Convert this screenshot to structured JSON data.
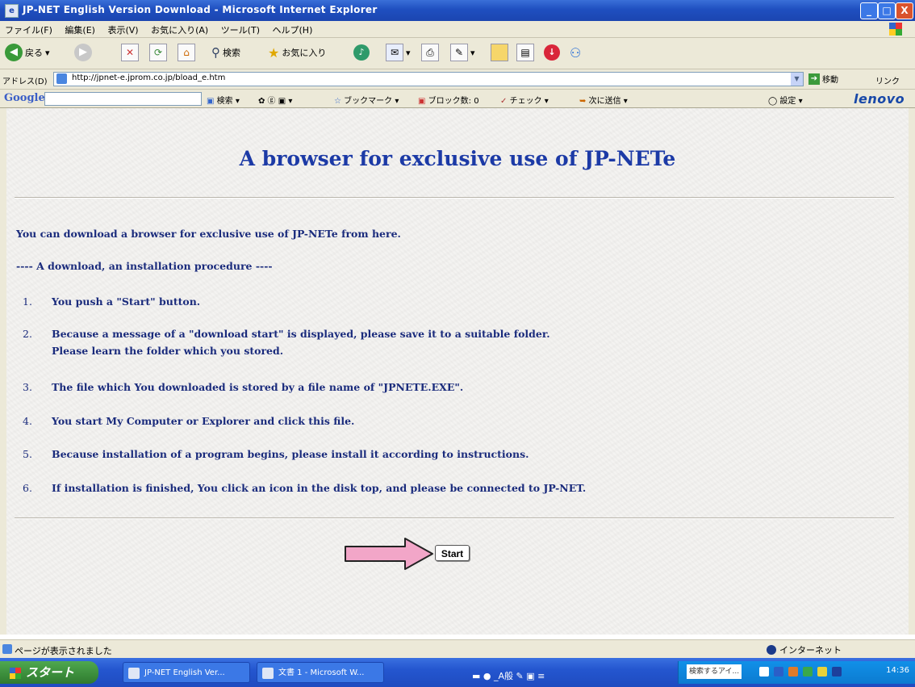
{
  "window": {
    "title": "JP-NET English Version Download - Microsoft Internet Explorer",
    "minimize": "_",
    "maximize": "□",
    "close": "X"
  },
  "menu": [
    "ファイル(F)",
    "編集(E)",
    "表示(V)",
    "お気に入り(A)",
    "ツール(T)",
    "ヘルプ(H)"
  ],
  "toolbar": {
    "back_label": "戻る",
    "search_label": "検索",
    "favorites_label": "お気に入り"
  },
  "address": {
    "label": "アドレス(D)",
    "url": "http://jpnet-e.jprom.co.jp/bload_e.htm",
    "go_label": "移動",
    "links_label": "リンク"
  },
  "google_bar": {
    "logo": "Google",
    "search_label": "検索",
    "bookmarks_label": "ブックマーク",
    "blocked_label": "ブロック数: 0",
    "check_label": "チェック",
    "send_label": "次に送信",
    "settings_label": "設定",
    "brand": "lenovo"
  },
  "page": {
    "title": "A browser for exclusive use of JP-NETe",
    "intro": "You can download a browser for exclusive use of JP-NETe from here.",
    "procedure_heading": "---- A download, an installation procedure ----",
    "steps": [
      {
        "num": "1.",
        "text": "You push a \"Start\" button."
      },
      {
        "num": "2.",
        "text": "Because a message of a \"download start\" is displayed, please save it to a suitable folder.",
        "text2": "Please learn the folder which you stored."
      },
      {
        "num": "3.",
        "text": "The file which You downloaded is stored by a file name of \"JPNETE.EXE\"."
      },
      {
        "num": "4.",
        "text": "You start My Computer or Explorer and click this file."
      },
      {
        "num": "5.",
        "text": "Because installation of a program begins, please install it according to instructions."
      },
      {
        "num": "6.",
        "text": "If installation is finished, You click an icon in the disk top, and please be connected to JP-NET."
      }
    ],
    "start_button": "Start"
  },
  "status": {
    "text": "ページが表示されました",
    "zone": "インターネット"
  },
  "taskbar": {
    "start_label": "スタート",
    "tasks": [
      "JP-NET English Ver...",
      "文書 1 - Microsoft W..."
    ],
    "tray_search": "検索するアイ...",
    "clock": "14:36"
  },
  "colors": {
    "titlebar": "#1f4fc0",
    "page_text": "#1a2b7c",
    "arrow_fill": "#f2a6c8"
  }
}
